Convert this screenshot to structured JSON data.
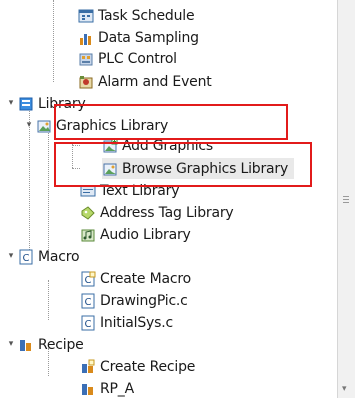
{
  "tree": {
    "items": [
      {
        "label": "Task Schedule",
        "icon": "schedule-icon"
      },
      {
        "label": "Data Sampling",
        "icon": "bar-chart-icon"
      },
      {
        "label": "PLC Control",
        "icon": "plc-icon"
      },
      {
        "label": "Alarm and Event",
        "icon": "alarm-icon"
      },
      {
        "label": "Library",
        "icon": "library-icon"
      },
      {
        "label": "Graphics Library",
        "icon": "graphics-library-icon"
      },
      {
        "label": "Add Graphics",
        "icon": "add-graphics-icon"
      },
      {
        "label": "Browse Graphics Library",
        "icon": "browse-graphics-icon"
      },
      {
        "label": "Text Library",
        "icon": "text-library-icon"
      },
      {
        "label": "Address Tag Library",
        "icon": "address-tag-icon"
      },
      {
        "label": "Audio Library",
        "icon": "audio-icon"
      },
      {
        "label": "Macro",
        "icon": "macro-icon"
      },
      {
        "label": "Create Macro",
        "icon": "create-macro-icon"
      },
      {
        "label": "DrawingPic.c",
        "icon": "c-file-icon"
      },
      {
        "label": "InitialSys.c",
        "icon": "c-file-icon"
      },
      {
        "label": "Recipe",
        "icon": "recipe-icon"
      },
      {
        "label": "Create Recipe",
        "icon": "create-recipe-icon"
      },
      {
        "label": "RP_A",
        "icon": "recipe-file-icon"
      }
    ]
  },
  "colors": {
    "highlight": "#e21b1b",
    "selection": "#e9e9e9"
  }
}
